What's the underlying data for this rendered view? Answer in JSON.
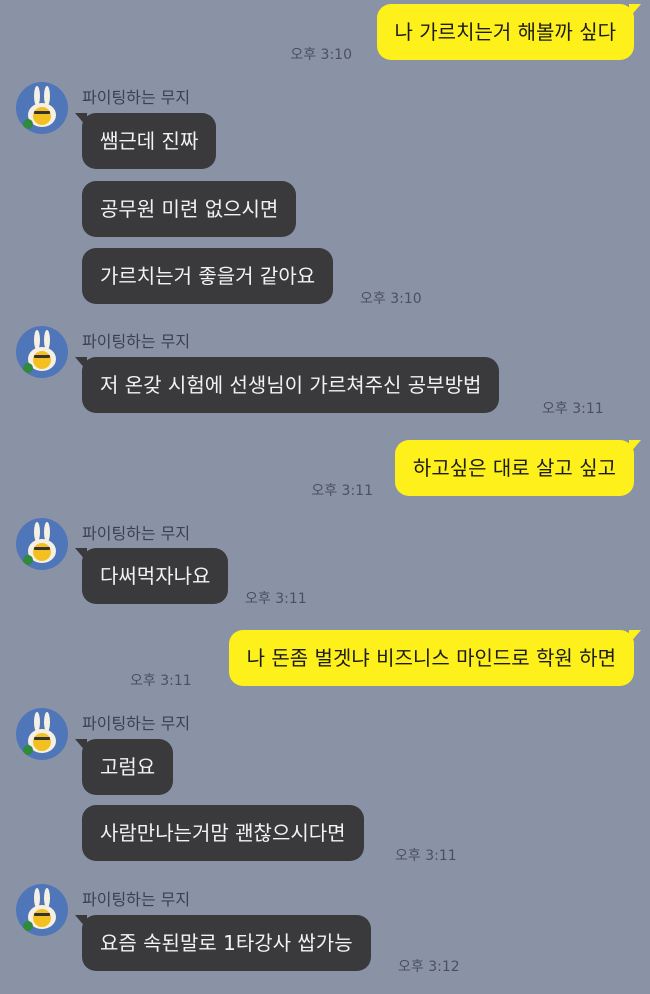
{
  "theme": {
    "background": "#8a93a6",
    "my_bubble": "#fef01b",
    "other_bubble": "#3a3a3d"
  },
  "sender_name": "파이팅하는 무지",
  "avatar_icon": "muzi-character-avatar",
  "messages": [
    {
      "from": "me",
      "text": "나 가르치는거 해볼까 싶다",
      "time": "오후 3:10"
    },
    {
      "from": "other",
      "text": "쌤근데 진짜",
      "time": ""
    },
    {
      "from": "other",
      "text": "공무원 미련 없으시면",
      "time": ""
    },
    {
      "from": "other",
      "text": "가르치는거 좋을거 같아요",
      "time": "오후 3:10"
    },
    {
      "from": "other",
      "text": "저 온갖 시험에 선생님이 가르쳐주신 공부방법",
      "time": "오후 3:11"
    },
    {
      "from": "me",
      "text": "하고싶은 대로 살고 싶고",
      "time": "오후 3:11"
    },
    {
      "from": "other",
      "text": "다써먹자나요",
      "time": "오후 3:11"
    },
    {
      "from": "me",
      "text": "나 돈좀 벌겟냐 비즈니스 마인드로 학원 하면",
      "time": "오후 3:11"
    },
    {
      "from": "other",
      "text": "고럼요",
      "time": ""
    },
    {
      "from": "other",
      "text": "사람만나는거맘 괜찮으시다면",
      "time": "오후 3:11"
    },
    {
      "from": "other",
      "text": "요즘 속된말로 1타강사 쌉가능",
      "time": "오후 3:12"
    }
  ]
}
